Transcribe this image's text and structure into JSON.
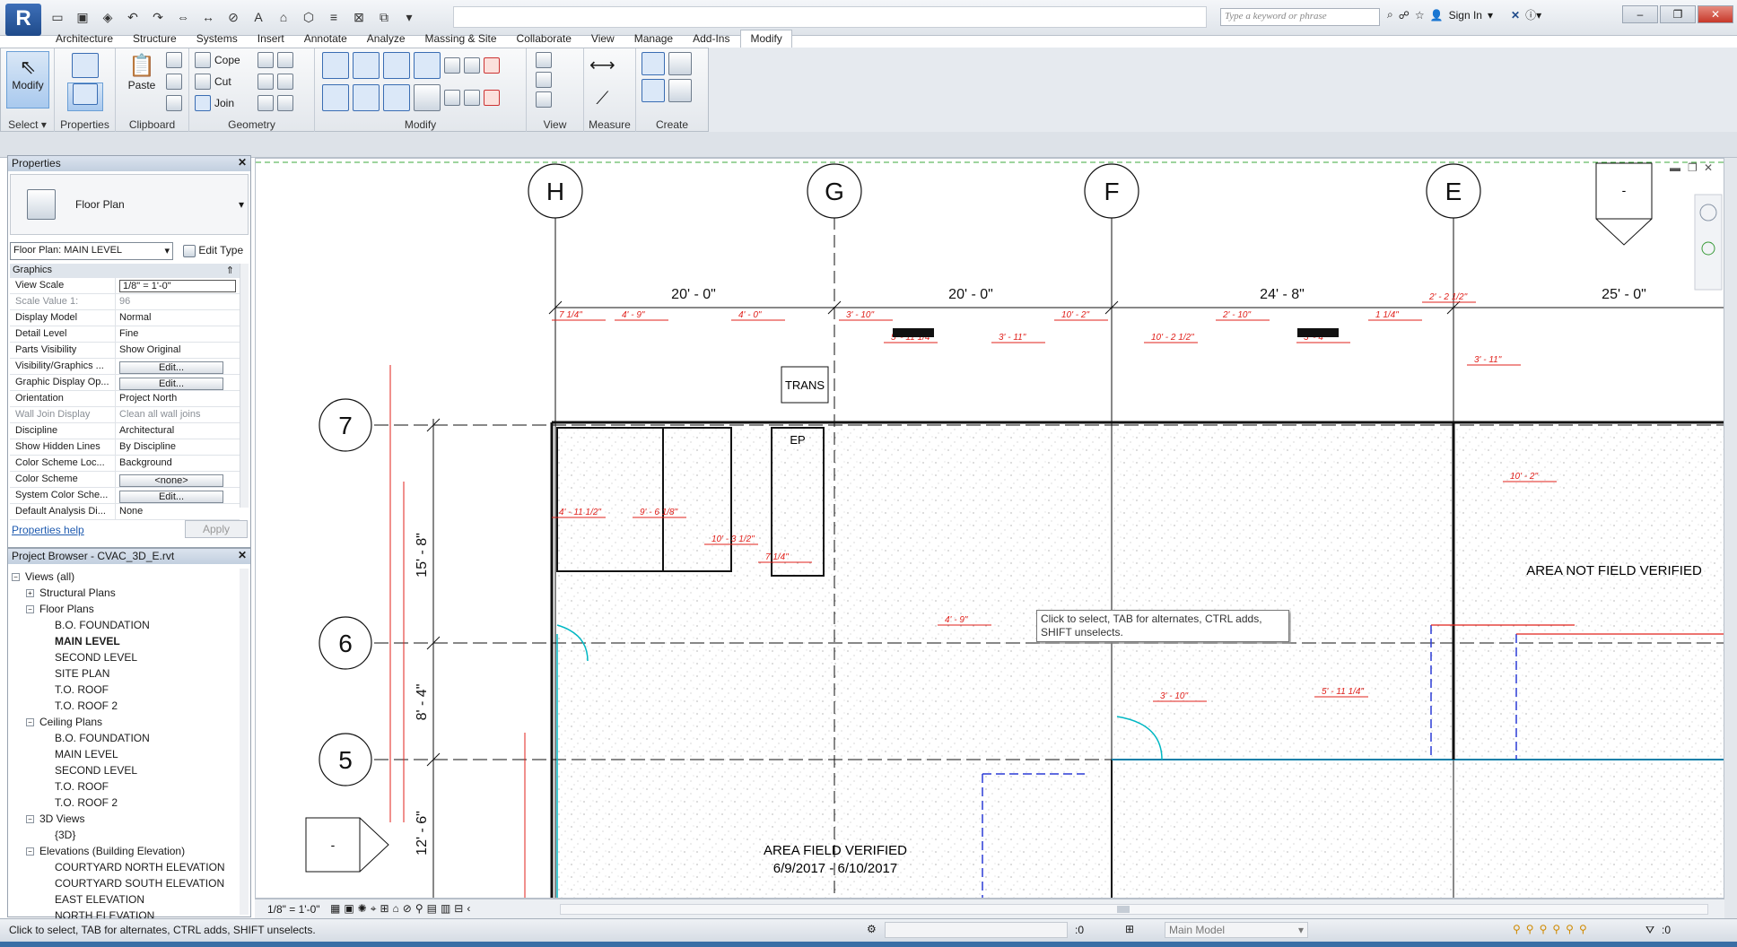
{
  "app": {
    "logo_letter": "R",
    "search_placeholder": "Type a keyword or phrase",
    "sign_in": "Sign In"
  },
  "tabs": [
    "Architecture",
    "Structure",
    "Systems",
    "Insert",
    "Annotate",
    "Analyze",
    "Massing & Site",
    "Collaborate",
    "View",
    "Manage",
    "Add-Ins",
    "Modify"
  ],
  "active_tab": "Modify",
  "ribbon": {
    "select": {
      "modify_label": "Modify",
      "title": "Select ▾"
    },
    "properties": {
      "title": "Properties"
    },
    "clipboard": {
      "paste": "Paste",
      "title": "Clipboard"
    },
    "geometry": {
      "cope": "Cope",
      "cut": "Cut",
      "join": "Join",
      "title": "Geometry"
    },
    "modify": {
      "title": "Modify"
    },
    "view": {
      "title": "View"
    },
    "measure": {
      "title": "Measure"
    },
    "create": {
      "title": "Create"
    }
  },
  "properties_pane": {
    "title": "Properties",
    "type_name": "Floor Plan",
    "view_selector": "Floor Plan: MAIN LEVEL",
    "edit_type": "Edit Type",
    "group": "Graphics",
    "rows": [
      {
        "k": "View Scale",
        "v": "1/8\" = 1'-0\"",
        "kind": "box"
      },
      {
        "k": "Scale Value    1:",
        "v": "96",
        "kind": "dim"
      },
      {
        "k": "Display Model",
        "v": "Normal"
      },
      {
        "k": "Detail Level",
        "v": "Fine"
      },
      {
        "k": "Parts Visibility",
        "v": "Show Original"
      },
      {
        "k": "Visibility/Graphics ...",
        "v": "Edit...",
        "kind": "btn"
      },
      {
        "k": "Graphic Display Op...",
        "v": "Edit...",
        "kind": "btn"
      },
      {
        "k": "Orientation",
        "v": "Project North"
      },
      {
        "k": "Wall Join Display",
        "v": "Clean all wall joins",
        "kind": "dim"
      },
      {
        "k": "Discipline",
        "v": "Architectural"
      },
      {
        "k": "Show Hidden Lines",
        "v": "By Discipline"
      },
      {
        "k": "Color Scheme Loc...",
        "v": "Background"
      },
      {
        "k": "Color Scheme",
        "v": "<none>",
        "kind": "btn"
      },
      {
        "k": "System Color Sche...",
        "v": "Edit...",
        "kind": "btn"
      },
      {
        "k": "Default Analysis Di...",
        "v": "None"
      }
    ],
    "help": "Properties help",
    "apply": "Apply"
  },
  "browser": {
    "title": "Project Browser - CVAC_3D_E.rvt",
    "tree": [
      {
        "label": "Views (all)",
        "level": 0,
        "pm": "−"
      },
      {
        "label": "Structural Plans",
        "level": 1,
        "pm": "+"
      },
      {
        "label": "Floor Plans",
        "level": 1,
        "pm": "−"
      },
      {
        "label": "B.O. FOUNDATION",
        "level": 2
      },
      {
        "label": "MAIN LEVEL",
        "level": 2,
        "bold": true
      },
      {
        "label": "SECOND LEVEL",
        "level": 2
      },
      {
        "label": "SITE PLAN",
        "level": 2
      },
      {
        "label": "T.O. ROOF",
        "level": 2
      },
      {
        "label": "T.O. ROOF 2",
        "level": 2
      },
      {
        "label": "Ceiling Plans",
        "level": 1,
        "pm": "−"
      },
      {
        "label": "B.O. FOUNDATION",
        "level": 2
      },
      {
        "label": "MAIN LEVEL",
        "level": 2
      },
      {
        "label": "SECOND LEVEL",
        "level": 2
      },
      {
        "label": "T.O. ROOF",
        "level": 2
      },
      {
        "label": "T.O. ROOF 2",
        "level": 2
      },
      {
        "label": "3D Views",
        "level": 1,
        "pm": "−"
      },
      {
        "label": "{3D}",
        "level": 2
      },
      {
        "label": "Elevations (Building Elevation)",
        "level": 1,
        "pm": "−"
      },
      {
        "label": "COURTYARD NORTH ELEVATION",
        "level": 2
      },
      {
        "label": "COURTYARD SOUTH ELEVATION",
        "level": 2
      },
      {
        "label": "EAST ELEVATION",
        "level": 2
      },
      {
        "label": "NORTH ELEVATION",
        "level": 2
      }
    ]
  },
  "drawing": {
    "grid_cols": [
      "H",
      "G",
      "F",
      "E"
    ],
    "grid_rows": [
      "7",
      "6",
      "5"
    ],
    "dims_top": [
      "20' - 0\"",
      "20' - 0\"",
      "24' - 8\"",
      "25' - 0\""
    ],
    "dims_left": [
      "15' - 8\"",
      "8' - 4\"",
      "12' - 6\""
    ],
    "trans": "TRANS",
    "ep": "EP",
    "area_not_verified": "AREA NOT FIELD VERIFIED",
    "area_verified": "AREA FIELD VERIFIED",
    "area_verified_dates": "6/9/2017 - 6/10/2017",
    "tooltip": "Click to select, TAB for alternates, CTRL adds, SHIFT unselects.",
    "elev_marker": "-",
    "red_dims": [
      "7 1/4\"",
      "4' - 9\"",
      "4' - 0\"",
      "3' - 10\"",
      "5' - 11 1/4\"",
      "3' - 11\"",
      "10' - 2\"",
      "10' - 2 1/2\"",
      "2' - 10\"",
      "3' - 4\"",
      "1 1/4\"",
      "2' - 2 1/2\"",
      "4' - 11 1/2\"",
      "9' - 6 1/8\"",
      "10' - 3 1/2\""
    ]
  },
  "viewbar": {
    "scale": "1/8\" = 1'-0\""
  },
  "status": {
    "message": "Click to select, TAB for alternates, CTRL adds, SHIFT unselects.",
    "sel_count": ":0",
    "workset": "Main Model",
    "filter_count": ":0"
  },
  "colors": {
    "accent": "#1f4a8a",
    "dim_red": "#e0201b",
    "wall": "#1a1a1a",
    "cyan": "#00b7c3",
    "blue_dash": "#2b3bd6"
  }
}
